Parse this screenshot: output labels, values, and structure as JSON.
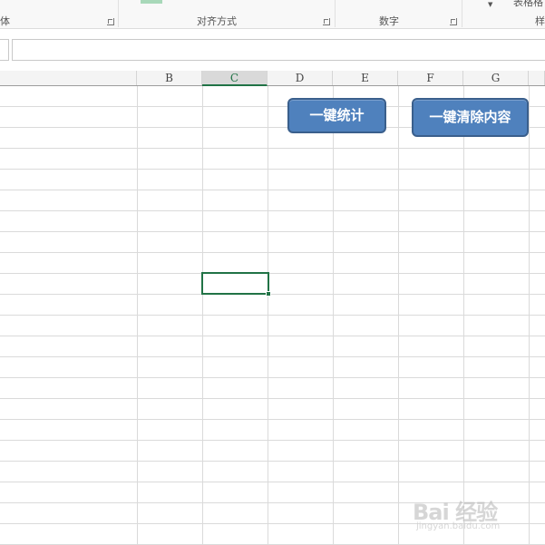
{
  "ribbon": {
    "groups": [
      {
        "label": "体"
      },
      {
        "label": "对齐方式"
      },
      {
        "label": "数字"
      },
      {
        "label": "样"
      }
    ],
    "clipped_top_label": "表格格"
  },
  "formula_bar": {
    "name_box_value": "",
    "formula_value": ""
  },
  "sheet": {
    "columns": [
      "B",
      "C",
      "D",
      "E",
      "F",
      "G"
    ],
    "active_column": "C",
    "active_cell": "C10"
  },
  "buttons": {
    "stats_label": "一键统计",
    "clear_label": "一键清除内容"
  },
  "watermark": {
    "main": "Bai 经验",
    "sub": "jingyan.baidu.com"
  },
  "colors": {
    "button_fill": "#4f81bd",
    "button_border": "#3a5f8c",
    "selection": "#217346"
  }
}
